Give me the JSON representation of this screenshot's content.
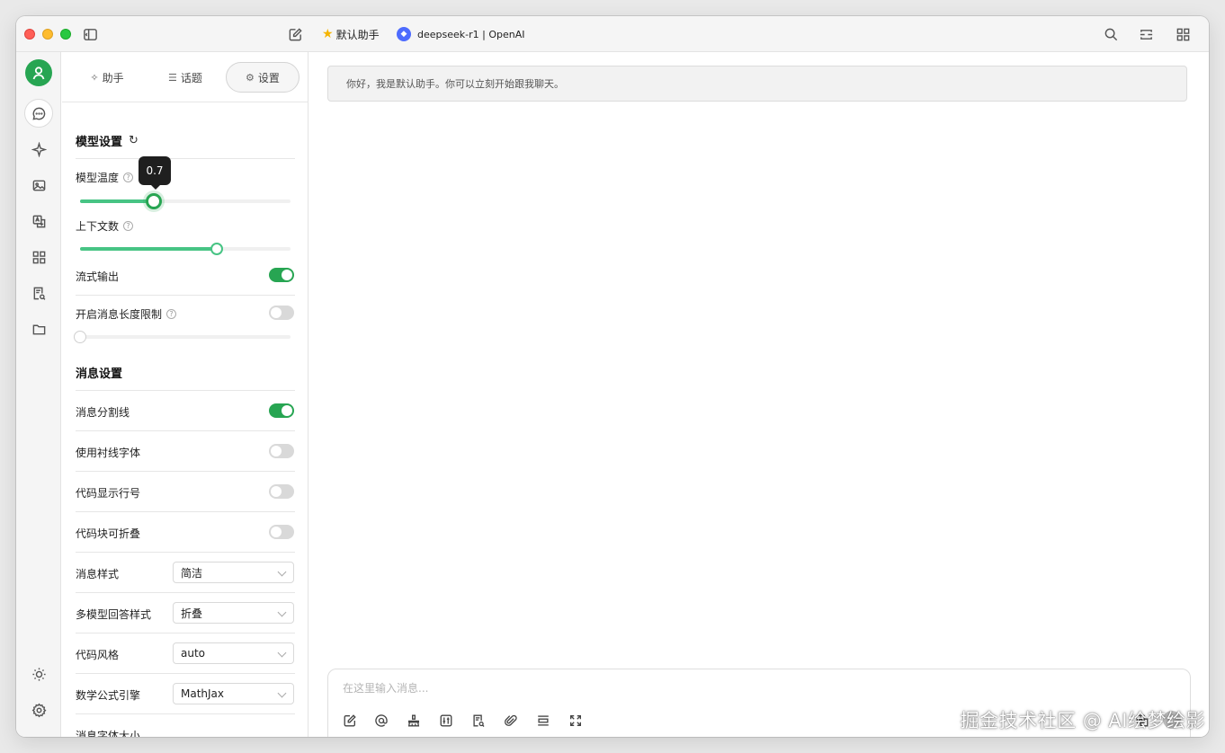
{
  "titlebar": {
    "assistant_name": "默认助手",
    "model_label": "deepseek-r1 | OpenAI"
  },
  "tabs": [
    {
      "label": "助手",
      "icon": "sparkle-icon"
    },
    {
      "label": "话题",
      "icon": "list-icon"
    },
    {
      "label": "设置",
      "icon": "gear-icon"
    }
  ],
  "model_settings": {
    "title": "模型设置",
    "temperature_label": "模型温度",
    "temperature_value": "0.7",
    "temperature_fraction": 0.35,
    "context_label": "上下文数",
    "context_fraction": 0.65,
    "stream_label": "流式输出",
    "stream_on": true,
    "max_length_label": "开启消息长度限制",
    "max_length_on": false,
    "max_length_fraction": 0.0
  },
  "message_settings": {
    "title": "消息设置",
    "divider_label": "消息分割线",
    "divider_on": true,
    "serif_label": "使用衬线字体",
    "serif_on": false,
    "line_numbers_label": "代码显示行号",
    "line_numbers_on": false,
    "collapsible_label": "代码块可折叠",
    "collapsible_on": false,
    "style_label": "消息样式",
    "style_value": "简洁",
    "multi_model_label": "多模型回答样式",
    "multi_model_value": "折叠",
    "code_style_label": "代码风格",
    "code_style_value": "auto",
    "math_label": "数学公式引擎",
    "math_value": "MathJax",
    "font_size_label": "消息字体大小"
  },
  "chat": {
    "greeting": "你好，我是默认助手。你可以立刻开始跟我聊天。",
    "input_placeholder": "在这里输入消息..."
  },
  "watermark": "掘金技术社区 @ AI绘梦绘影",
  "colors": {
    "accent": "#27a552",
    "slider_fill": "#47c484",
    "tooltip_bg": "#1f1f1f"
  }
}
